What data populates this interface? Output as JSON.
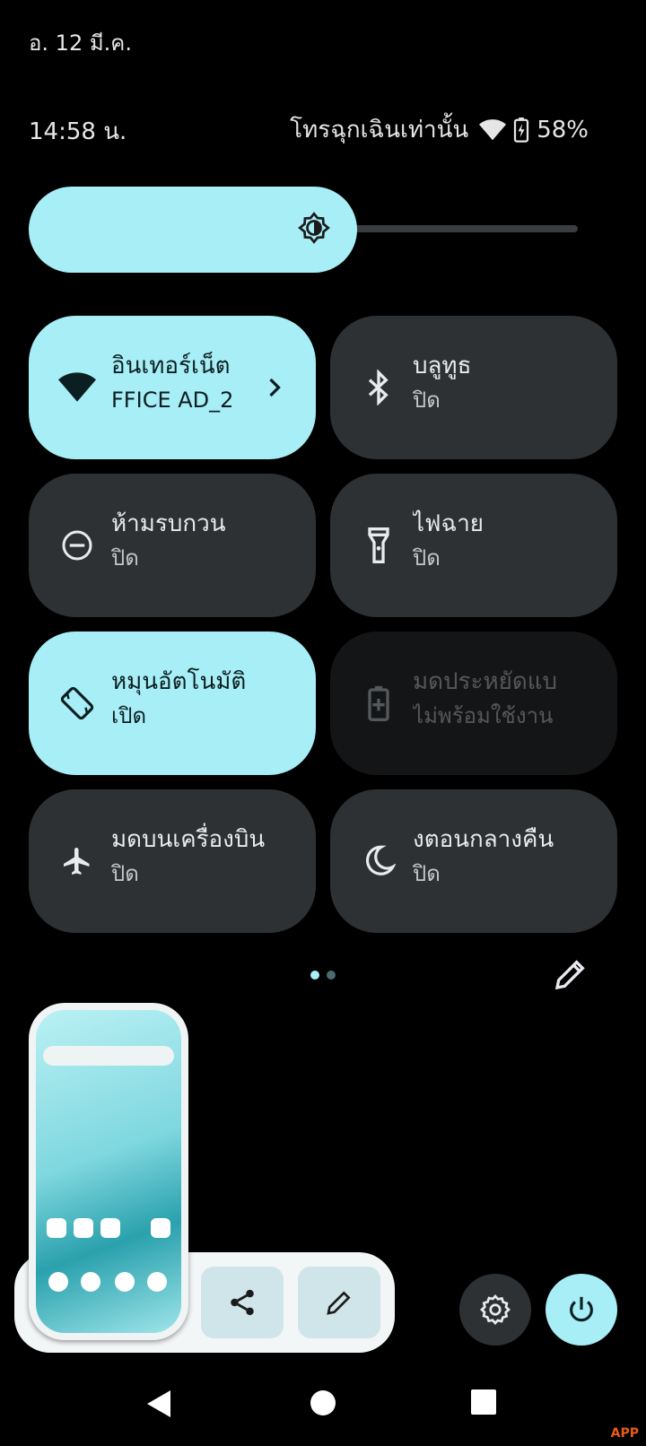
{
  "status": {
    "date": "อ. 12 มี.ค.",
    "time": "14:58 น.",
    "emergency": "โทรฉุกเฉินเท่านั้น",
    "battery": "58%"
  },
  "brightness": {
    "level": 0.58,
    "icon": "brightness-icon"
  },
  "tiles": [
    {
      "title": "อินเทอร์เน็ต",
      "sub": "FFICE AD_2",
      "state": "on",
      "icon": "wifi-icon"
    },
    {
      "title": "บลูทูธ",
      "sub": "ปิด",
      "state": "off",
      "icon": "bluetooth-icon"
    },
    {
      "title": "ห้ามรบกวน",
      "sub": "ปิด",
      "state": "off",
      "icon": "do-not-disturb-icon"
    },
    {
      "title": "ไฟฉาย",
      "sub": "ปิด",
      "state": "off",
      "icon": "flashlight-icon"
    },
    {
      "title": "หมุนอัตโนมัติ",
      "sub": "เปิด",
      "state": "on",
      "icon": "auto-rotate-icon"
    },
    {
      "title": "มดประหยัดแบ",
      "sub": "ไม่พร้อมใช้งาน",
      "state": "unavailable",
      "icon": "battery-saver-icon"
    },
    {
      "title": "มดบนเครื่องบิน",
      "sub": "ปิด",
      "state": "off",
      "icon": "airplane-icon"
    },
    {
      "title": "งตอนกลางคืน",
      "sub": "ปิด",
      "state": "off",
      "icon": "night-light-icon"
    }
  ],
  "pager": {
    "pages": 2,
    "current": 1
  },
  "colors": {
    "accent": "#a8eef6",
    "tile_off": "#2e3133",
    "background": "#000000"
  },
  "watermark": "APP"
}
